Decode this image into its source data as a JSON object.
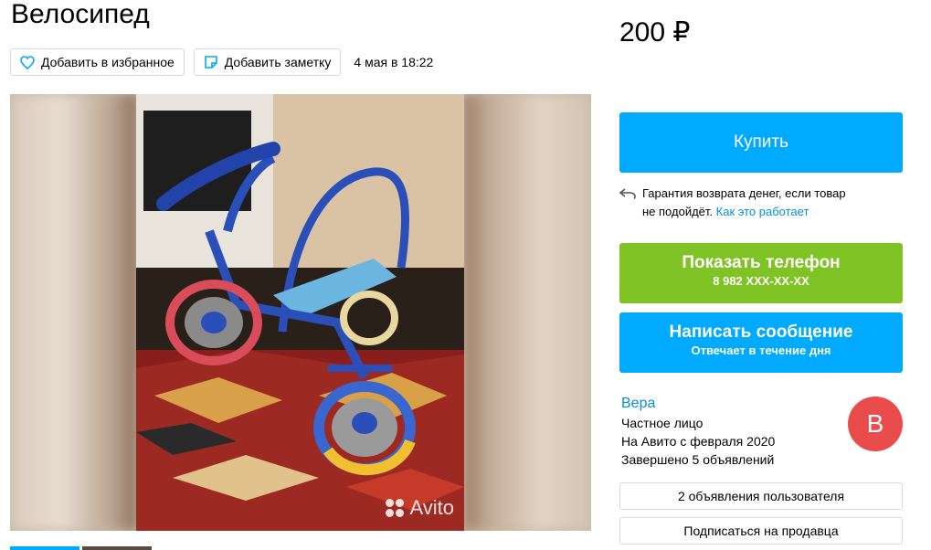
{
  "listing": {
    "title": "Велосипед",
    "price": "200 ₽",
    "favorite_label": "Добавить в избранное",
    "note_label": "Добавить заметку",
    "date": "4 мая в 18:22"
  },
  "gallery": {
    "watermark": "Avito"
  },
  "purchase": {
    "buy_label": "Купить",
    "guarantee_text": "Гарантия возврата денег, если товар",
    "guarantee_text2": "не подойдёт.",
    "guarantee_link": "Как это работает"
  },
  "contact": {
    "phone_label": "Показать телефон",
    "phone_number": "8 982 XXX-XX-XX",
    "message_label": "Написать сообщение",
    "message_sub": "Отвечает в течение дня"
  },
  "seller": {
    "name": "Вера",
    "type": "Частное лицо",
    "since": "На Авито с февраля 2020",
    "completed": "Завершено 5 объявлений",
    "avatar_letter": "В",
    "ads_label": "2 объявления пользователя",
    "subscribe_label": "Подписаться на продавца"
  },
  "colors": {
    "accent_blue": "#00aaff",
    "accent_green": "#7fc324",
    "link": "#0091d9",
    "avatar": "#ea4c4c"
  }
}
